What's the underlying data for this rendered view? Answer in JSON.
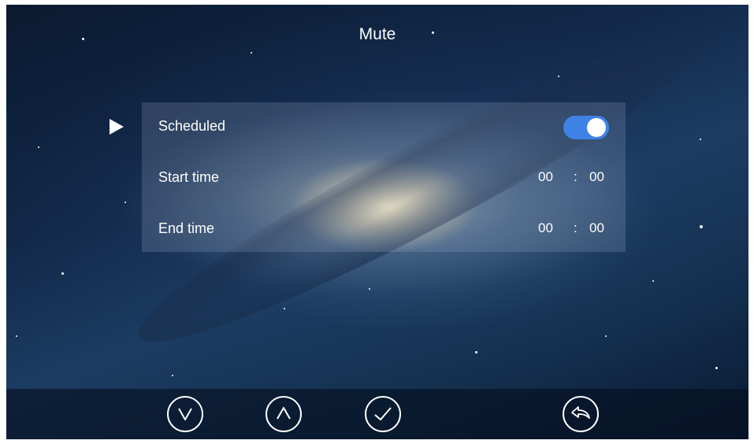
{
  "screen": {
    "title": "Mute"
  },
  "settings": {
    "rows": [
      {
        "label": "Scheduled",
        "type": "toggle",
        "enabled": true
      },
      {
        "label": "Start time",
        "type": "time",
        "hours": "00",
        "separator": ":",
        "minutes": "00"
      },
      {
        "label": "End time",
        "type": "time",
        "hours": "00",
        "separator": ":",
        "minutes": "00"
      }
    ]
  },
  "toolbar": {
    "buttons": [
      {
        "name": "down",
        "icon": "chevron-down-icon"
      },
      {
        "name": "up",
        "icon": "chevron-up-icon"
      },
      {
        "name": "confirm",
        "icon": "check-icon"
      },
      {
        "name": "back",
        "icon": "back-arrow-icon"
      }
    ]
  },
  "colors": {
    "toggle_on": "#3f82e6",
    "text": "#ffffff"
  }
}
